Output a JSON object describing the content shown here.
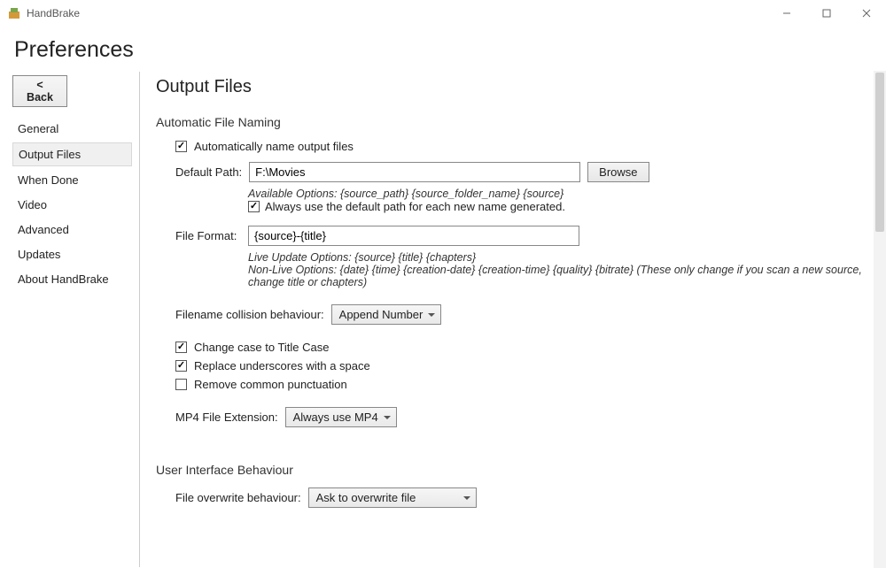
{
  "window": {
    "title": "HandBrake"
  },
  "header": {
    "title": "Preferences"
  },
  "sidebar": {
    "back_label": "< Back",
    "items": [
      {
        "label": "General"
      },
      {
        "label": "Output Files"
      },
      {
        "label": "When Done"
      },
      {
        "label": "Video"
      },
      {
        "label": "Advanced"
      },
      {
        "label": "Updates"
      },
      {
        "label": "About HandBrake"
      }
    ],
    "selected_index": 1
  },
  "main": {
    "page_title": "Output Files",
    "section_auto": {
      "title": "Automatic File Naming",
      "auto_name_label": "Automatically name output files",
      "auto_name_checked": true,
      "default_path_label": "Default Path:",
      "default_path_value": "F:\\Movies",
      "browse_label": "Browse",
      "default_path_hint": "Available Options: {source_path} {source_folder_name} {source}",
      "always_default_label": "Always use the default path for each new name generated.",
      "always_default_checked": true,
      "file_format_label": "File Format:",
      "file_format_value": "{source}-{title}",
      "file_format_hint1": "Live Update Options: {source} {title} {chapters}",
      "file_format_hint2": "Non-Live Options: {date} {time} {creation-date} {creation-time} {quality} {bitrate}  (These only change if you scan a new source, change title or chapters)",
      "collision_label": "Filename collision behaviour:",
      "collision_value": "Append Number",
      "titlecase_label": "Change case to Title Case",
      "titlecase_checked": true,
      "underscore_label": "Replace underscores with a space",
      "underscore_checked": true,
      "punct_label": "Remove common punctuation",
      "punct_checked": false,
      "mp4_label": "MP4 File Extension:",
      "mp4_value": "Always use MP4"
    },
    "section_ui": {
      "title": "User Interface Behaviour",
      "overwrite_label": "File overwrite behaviour:",
      "overwrite_value": "Ask to overwrite file"
    }
  }
}
